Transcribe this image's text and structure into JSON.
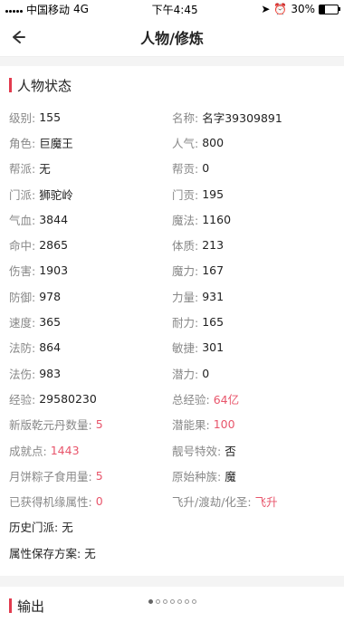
{
  "status_bar": {
    "carrier": "中国移动",
    "network": "4G",
    "time": "下午4:45",
    "battery": "30%",
    "battery_level": 0.3
  },
  "nav": {
    "title": "人物/修炼"
  },
  "section1": {
    "title": "人物状态",
    "rows": [
      [
        {
          "k": "级别:",
          "v": "155"
        },
        {
          "k": "名称:",
          "v": "名字39309891"
        }
      ],
      [
        {
          "k": "角色:",
          "v": "巨魔王"
        },
        {
          "k": "人气:",
          "v": "800"
        }
      ],
      [
        {
          "k": "帮派:",
          "v": "无"
        },
        {
          "k": "帮贡:",
          "v": "0"
        }
      ],
      [
        {
          "k": "门派:",
          "v": "狮驼岭"
        },
        {
          "k": "门贡:",
          "v": "195"
        }
      ],
      [
        {
          "k": "气血:",
          "v": "3844"
        },
        {
          "k": "魔法:",
          "v": "1160"
        }
      ],
      [
        {
          "k": "命中:",
          "v": "2865"
        },
        {
          "k": "体质:",
          "v": "213"
        }
      ],
      [
        {
          "k": "伤害:",
          "v": "1903"
        },
        {
          "k": "魔力:",
          "v": "167"
        }
      ],
      [
        {
          "k": "防御:",
          "v": "978"
        },
        {
          "k": "力量:",
          "v": "931"
        }
      ],
      [
        {
          "k": "速度:",
          "v": "365"
        },
        {
          "k": "耐力:",
          "v": "165"
        }
      ],
      [
        {
          "k": "法防:",
          "v": "864"
        },
        {
          "k": "敏捷:",
          "v": "301"
        }
      ],
      [
        {
          "k": "法伤:",
          "v": "983"
        },
        {
          "k": "潜力:",
          "v": "0"
        }
      ],
      [
        {
          "k": "经验:",
          "v": "29580230"
        },
        {
          "k": "总经验:",
          "v": "64亿"
        }
      ],
      [
        {
          "k": "新版乾元丹数量:",
          "v": "5"
        },
        {
          "k": "潜能果:",
          "v": "100"
        }
      ],
      [
        {
          "k": "成就点:",
          "v": "1443"
        },
        {
          "k": "靓号特效:",
          "v": "否"
        }
      ],
      [
        {
          "k": "月饼粽子食用量:",
          "v": "5"
        },
        {
          "k": "原始种族:",
          "v": "魔"
        }
      ],
      [
        {
          "k": "已获得机缘属性:",
          "v": "0"
        },
        {
          "k": "飞升/渡劫/化圣:",
          "v": "飞升"
        }
      ]
    ],
    "single_rows": [
      {
        "k": "历史门派:",
        "v": "无"
      },
      {
        "k": "属性保存方案:",
        "v": "无"
      }
    ]
  },
  "section2": {
    "title": "输出"
  },
  "pager": {
    "count": 7,
    "active": 0
  }
}
